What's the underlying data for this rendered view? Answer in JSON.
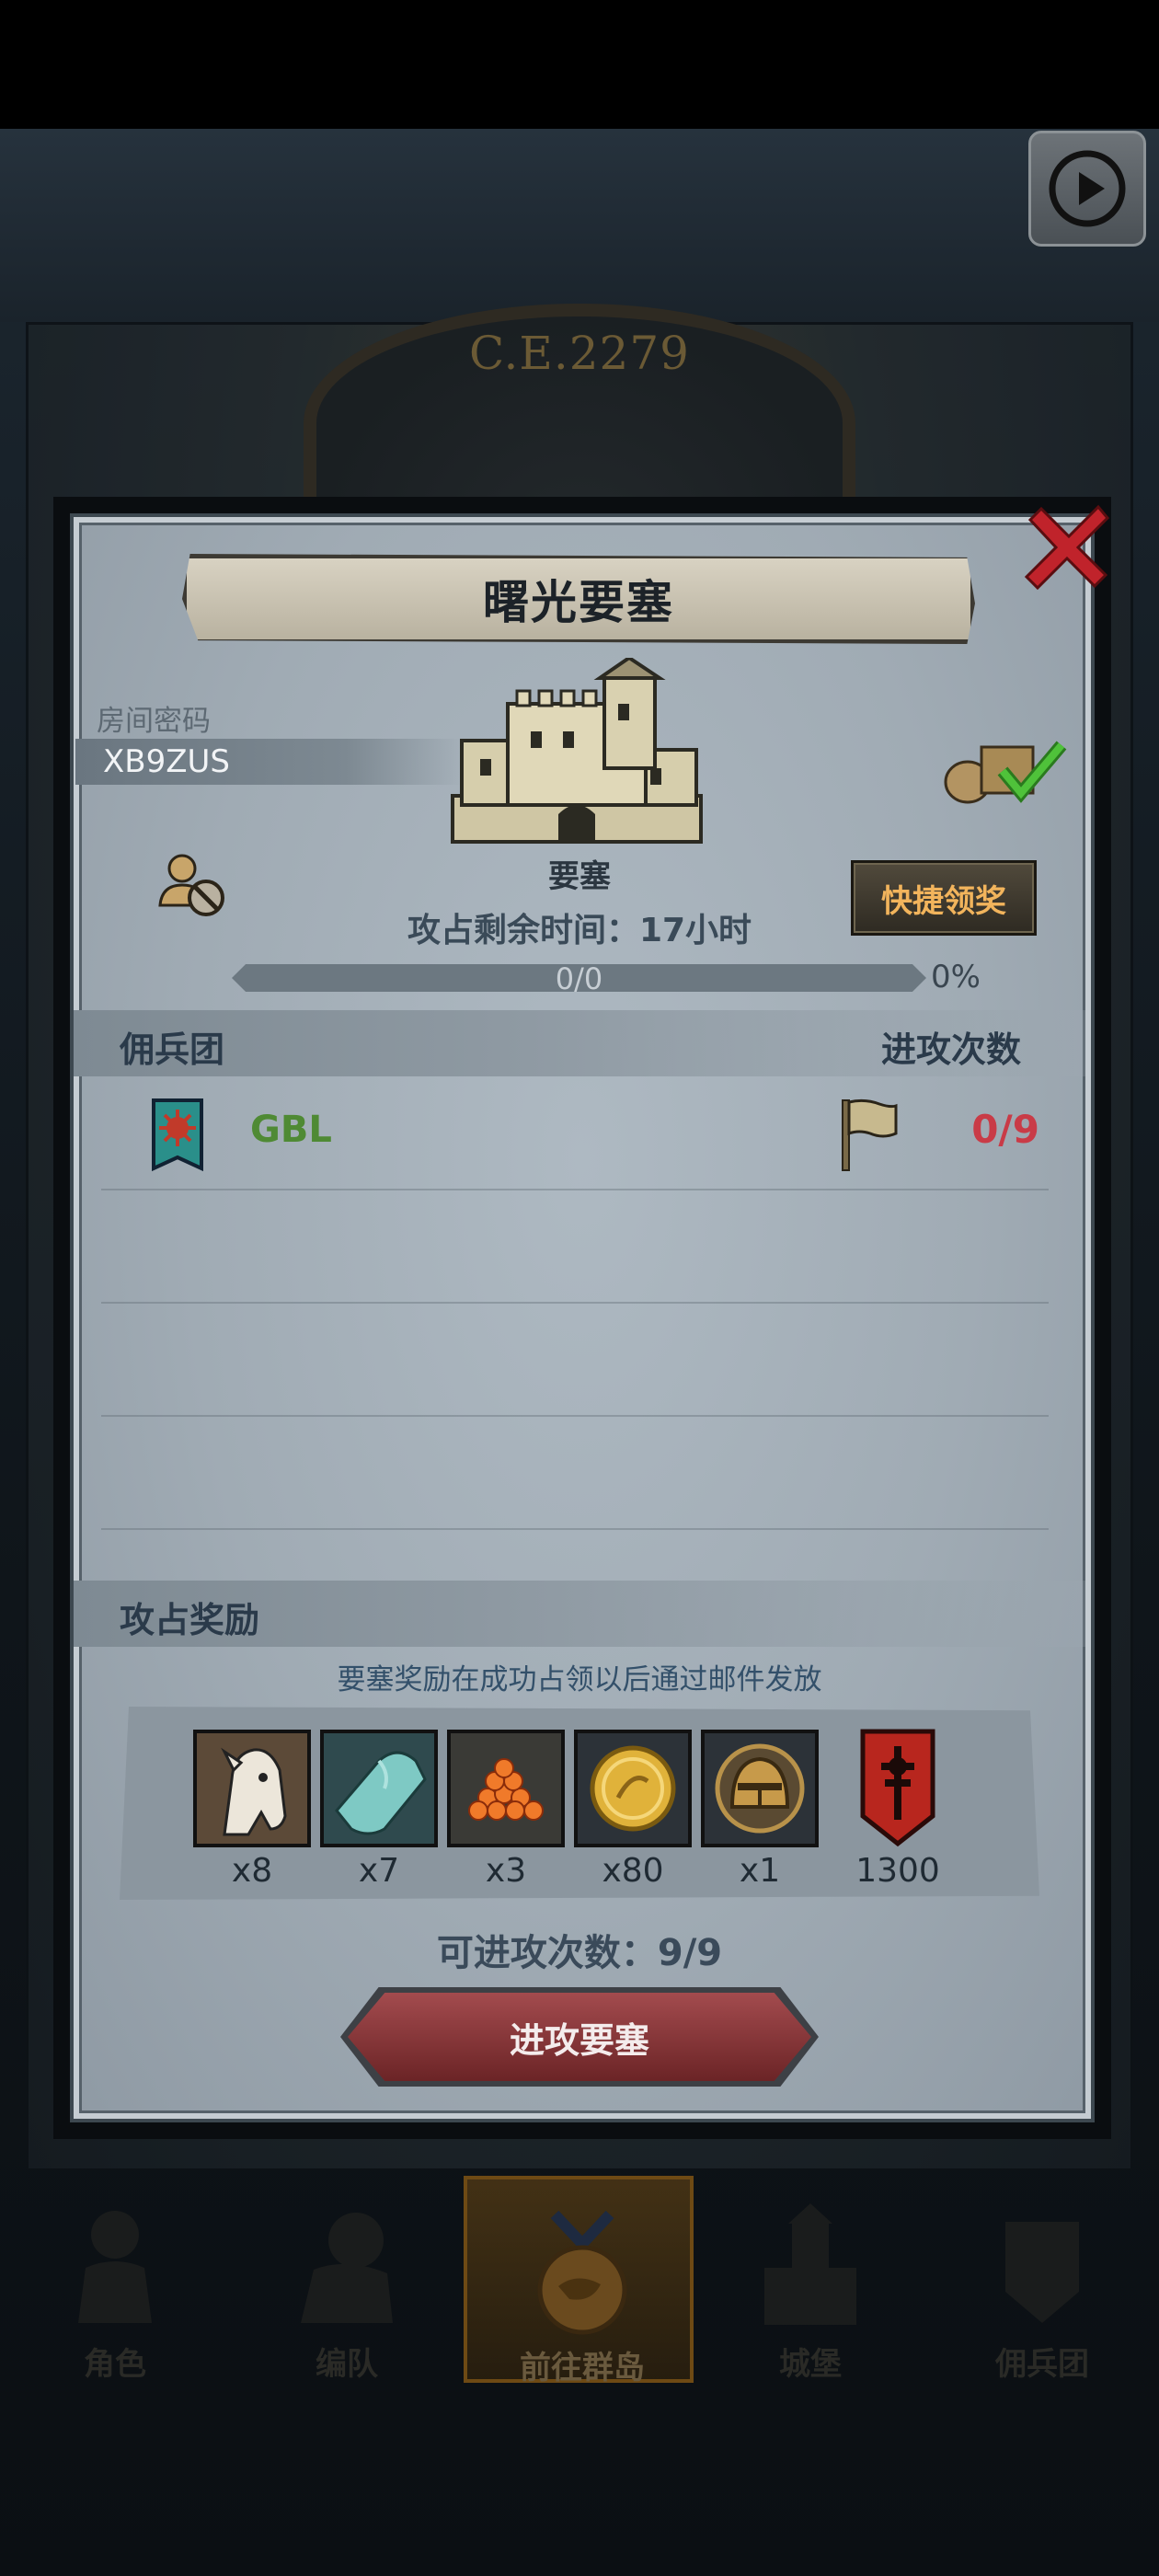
{
  "background": {
    "era_label": "C.E.2279"
  },
  "replay_button": {
    "icon": "play-icon"
  },
  "dialog": {
    "title": "曙光要塞",
    "room": {
      "label": "房间密码",
      "code": "XB9ZUS"
    },
    "fortress_label": "要塞",
    "quick_claim_label": "快捷领奖",
    "time_remaining": "攻占剩余时间：17小时",
    "progress": {
      "value_text": "0/0",
      "percent_text": "0%",
      "fraction": 0
    },
    "roster": {
      "left_header": "佣兵团",
      "right_header": "进攻次数",
      "rows": [
        {
          "guild_name": "GBL",
          "attack_count": "0/9"
        }
      ]
    },
    "rewards": {
      "header": "攻占奖励",
      "note": "要塞奖励在成功占领以后通过邮件发放",
      "items": [
        {
          "icon": "horse-icon",
          "qty": "x8"
        },
        {
          "icon": "cloth-icon",
          "qty": "x7"
        },
        {
          "icon": "roe-icon",
          "qty": "x3"
        },
        {
          "icon": "gold-coin-icon",
          "qty": "x80"
        },
        {
          "icon": "knight-helmet-icon",
          "qty": "x1"
        },
        {
          "icon": "guild-banner-icon",
          "qty": "1300"
        }
      ]
    },
    "remaining_attacks": "可进攻次数：9/9",
    "attack_button_label": "进攻要塞"
  },
  "bottom_nav": {
    "items": [
      {
        "label": "角色",
        "icon": "knight-icon",
        "active": false
      },
      {
        "label": "编队",
        "icon": "formation-icon",
        "active": false
      },
      {
        "label": "前往群岛",
        "icon": "islands-icon",
        "active": true
      },
      {
        "label": "城堡",
        "icon": "castle-icon",
        "active": false
      },
      {
        "label": "佣兵团",
        "icon": "mercenary-icon",
        "active": false
      }
    ]
  },
  "colors": {
    "accent_gold": "#f2b45c",
    "guild_green": "#4f8a34",
    "attack_red": "#c93b47",
    "button_red": "#8a3538"
  }
}
